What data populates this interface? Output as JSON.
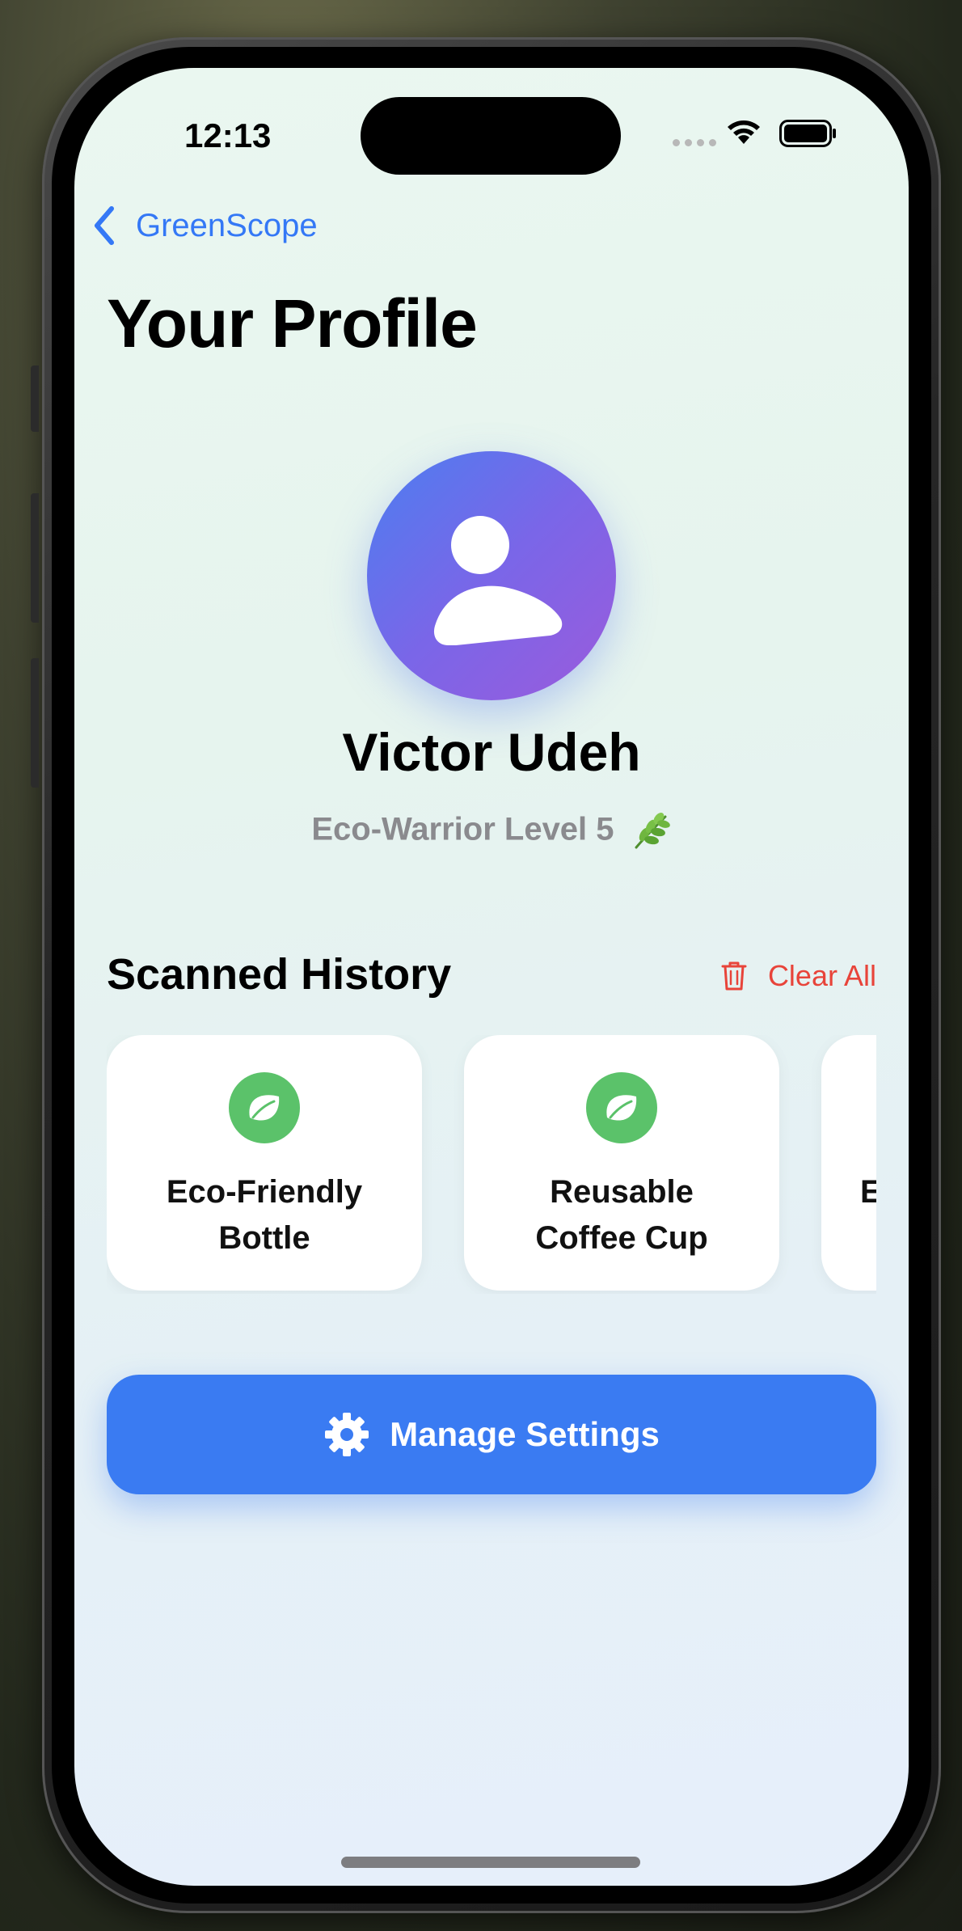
{
  "status_bar": {
    "time": "12:13"
  },
  "nav": {
    "back_label": "GreenScope"
  },
  "page": {
    "title": "Your Profile"
  },
  "profile": {
    "name": "Victor Udeh",
    "level": "Eco-Warrior Level 5"
  },
  "history": {
    "title": "Scanned History",
    "clear_all_label": "Clear All",
    "items": [
      {
        "line1": "Eco-Friendly",
        "line2": "Bottle",
        "icon": "leaf-icon"
      },
      {
        "line1": "Reusable",
        "line2": "Coffee Cup",
        "icon": "leaf-icon"
      },
      {
        "line1": "E",
        "line2": "",
        "icon": "leaf-icon"
      }
    ]
  },
  "actions": {
    "settings_label": "Manage Settings"
  },
  "colors": {
    "accent_blue": "#3478f6",
    "button_blue": "#3a7bf2",
    "destructive_red": "#e8443a",
    "leaf_green": "#5bc26a",
    "avatar_gradient_start": "#4c7ef0",
    "avatar_gradient_end": "#9b5bdc"
  }
}
